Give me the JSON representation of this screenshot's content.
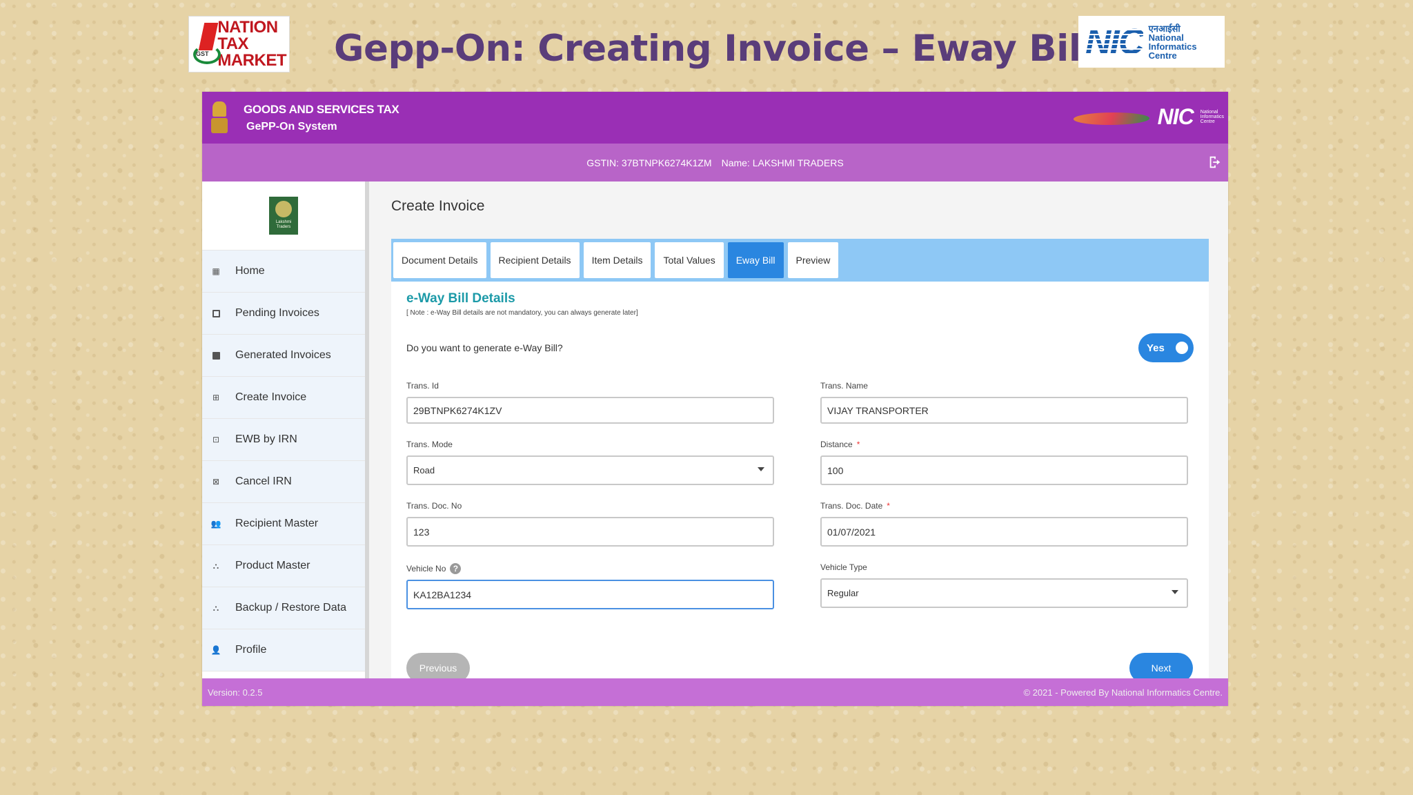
{
  "slide": {
    "title": "Gepp-On: Creating Invoice – Eway Bill Detail",
    "left_logo": [
      "NATION",
      "TAX",
      "MARKET"
    ],
    "left_logo_badge": "GST",
    "right_logo_main": "NIC",
    "right_logo_sub": [
      "एनआईसी",
      "National",
      "Informatics",
      "Centre"
    ]
  },
  "app": {
    "header": {
      "line1": "GOODS AND SERVICES TAX",
      "line2": "GePP-On System",
      "nic_small": "NIC"
    },
    "subheader": {
      "gstin": "GSTIN: 37BTNPK6274K1ZM",
      "name": "Name: LAKSHMI TRADERS"
    },
    "sidebar": {
      "items": [
        {
          "label": "Home"
        },
        {
          "label": "Pending Invoices"
        },
        {
          "label": "Generated Invoices"
        },
        {
          "label": "Create Invoice"
        },
        {
          "label": "EWB by IRN"
        },
        {
          "label": "Cancel IRN"
        },
        {
          "label": "Recipient Master"
        },
        {
          "label": "Product Master"
        },
        {
          "label": "Backup / Restore Data"
        },
        {
          "label": "Profile"
        }
      ]
    },
    "main": {
      "page_title": "Create Invoice",
      "tabs": [
        {
          "label": "Document Details"
        },
        {
          "label": "Recipient Details"
        },
        {
          "label": "Item Details"
        },
        {
          "label": "Total Values"
        },
        {
          "label": "Eway Bill",
          "active": true
        },
        {
          "label": "Preview"
        }
      ],
      "section_title": "e-Way Bill Details",
      "section_note": "[ Note : e-Way Bill details are not mandatory, you can always generate later]",
      "question": "Do you want to generate e-Way Bill?",
      "toggle_label": "Yes",
      "fields": {
        "trans_id": {
          "label": "Trans. Id",
          "value": "29BTNPK6274K1ZV"
        },
        "trans_name": {
          "label": "Trans. Name",
          "value": "VIJAY TRANSPORTER"
        },
        "trans_mode": {
          "label": "Trans. Mode",
          "value": "Road"
        },
        "distance": {
          "label": "Distance",
          "required": "*",
          "value": "100"
        },
        "trans_doc_no": {
          "label": "Trans. Doc. No",
          "value": "123"
        },
        "trans_doc_date": {
          "label": "Trans. Doc. Date",
          "required": "*",
          "value": "01/07/2021"
        },
        "vehicle_no": {
          "label": "Vehicle No",
          "help": "?",
          "value": "KA12BA1234"
        },
        "vehicle_type": {
          "label": "Vehicle Type",
          "value": "Regular"
        }
      },
      "previous_label": "Previous",
      "next_label": "Next"
    },
    "footer": {
      "version": "Version: 0.2.5",
      "copyright": "© 2021 - Powered By National Informatics Centre."
    }
  },
  "colors": {
    "header_purple": "#9a2fb5",
    "subheader_purple": "#b864c8",
    "accent_blue": "#2a86e0",
    "tabs_bar": "#8ec8f5",
    "section_teal": "#1c9aa8",
    "title_purple": "#5a3d7a"
  }
}
